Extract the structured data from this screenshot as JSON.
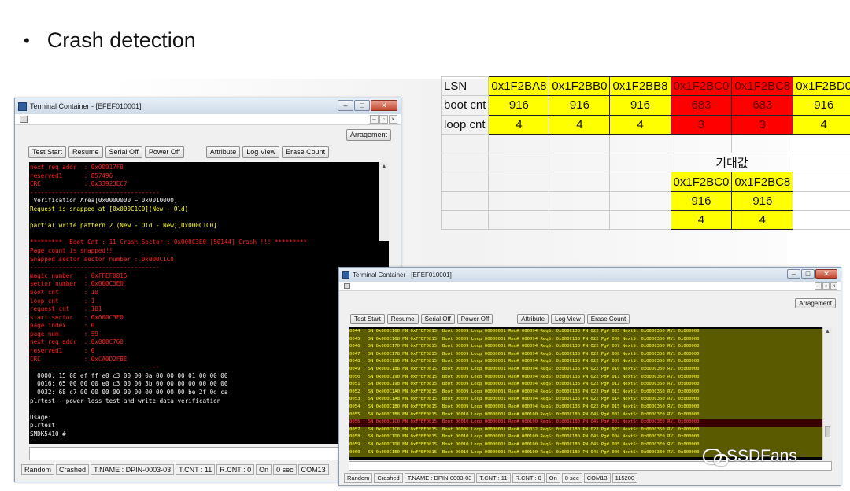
{
  "slide": {
    "bullet": "•",
    "title": "Crash detection"
  },
  "table": {
    "header_label": "LSN",
    "lsn": [
      "0x1F2BA8",
      "0x1F2BB0",
      "0x1F2BB8",
      "0x1F2BC0",
      "0x1F2BC8",
      "0x1F2BD0"
    ],
    "boot_label": "boot cnt",
    "boot": [
      "916",
      "916",
      "916",
      "683",
      "683",
      "916"
    ],
    "loop_label": "loop cnt",
    "loop": [
      "4",
      "4",
      "4",
      "3",
      "3",
      "4"
    ],
    "expected_label": "기대값",
    "expected_lsn": [
      "0x1F2BC0",
      "0x1F2BC8"
    ],
    "expected_boot": [
      "916",
      "916"
    ],
    "expected_loop": [
      "4",
      "4"
    ],
    "colors": {
      "ok": "#ffff00",
      "crash": "#ff0000"
    }
  },
  "win1": {
    "title": "Terminal Container - [EFEF010001]",
    "arrangement": "Arragement",
    "buttons": [
      "Test Start",
      "Resume",
      "Serial Off",
      "Power Off",
      "Attribute",
      "Log View",
      "Erase Count"
    ],
    "lines": [
      {
        "t": "next req addr  : 0x00017F8",
        "c": "c-red"
      },
      {
        "t": "reserved1      : 857496",
        "c": "c-red"
      },
      {
        "t": "CRC            : 0x33923EC7",
        "c": "c-red"
      },
      {
        "t": "------------------------------------",
        "c": "c-red"
      },
      {
        "t": " Verification Area[0x0000000 ~ 0x0010000]",
        "c": "c-wht"
      },
      {
        "t": "Request is snapped at [0x000C1C0](New - Old)",
        "c": "c-yel"
      },
      {
        "t": "",
        "c": "c-wht"
      },
      {
        "t": "partial write pattern 2 (New - Old - New)[0x000C1C0]",
        "c": "c-yel"
      },
      {
        "t": "",
        "c": "c-wht"
      },
      {
        "t": "*********  Boot Cnt : 11 Crash Sector : 0x000C3E0 [50144] Crash !!! *********",
        "c": "c-red"
      },
      {
        "t": "Page count is snapped!!",
        "c": "c-red"
      },
      {
        "t": "Snapped sector sector number : 0x000C1C0",
        "c": "c-red"
      },
      {
        "t": "------------------------------------",
        "c": "c-red"
      },
      {
        "t": "magic number   : 0xFFEF0815",
        "c": "c-red"
      },
      {
        "t": "sector number  : 0x000C3E0",
        "c": "c-red"
      },
      {
        "t": "boot cnt       : 10",
        "c": "c-red"
      },
      {
        "t": "loop cnt       : 1",
        "c": "c-red"
      },
      {
        "t": "request cnt    : 101",
        "c": "c-red"
      },
      {
        "t": "start sector   : 0x000C3E0",
        "c": "c-red"
      },
      {
        "t": "page index     : 0",
        "c": "c-red"
      },
      {
        "t": "page num       : 59",
        "c": "c-red"
      },
      {
        "t": "next req addr  : 0x000C760",
        "c": "c-red"
      },
      {
        "t": "reserved1      : 0",
        "c": "c-red"
      },
      {
        "t": "CRC            : 0xCA0D2FBE",
        "c": "c-red"
      },
      {
        "t": "------------------------------------",
        "c": "c-red"
      },
      {
        "t": "  0000: 15 08 ef ff e0 c3 00 00 0a 00 00 00 01 00 00 00",
        "c": "c-wht"
      },
      {
        "t": "  0016: 65 00 00 00 e0 c3 00 00 3b 00 00 00 00 00 00 00",
        "c": "c-wht"
      },
      {
        "t": "  0032: 68 c7 00 00 00 00 00 00 00 00 00 00 be 2f 0d ca",
        "c": "c-wht"
      },
      {
        "t": "plrtest - power loss test and write data verification",
        "c": "c-wht"
      },
      {
        "t": "",
        "c": "c-wht"
      },
      {
        "t": "Usage:",
        "c": "c-wht"
      },
      {
        "t": "plrtest",
        "c": "c-wht"
      },
      {
        "t": "SMDK5410 #",
        "c": "c-wht"
      }
    ],
    "status": [
      "Random",
      "Crashed",
      "T.NAME : DPIN-0003-03",
      "T.CNT : 11",
      "R.CNT : 0",
      "On",
      "0 sec",
      "COM13"
    ]
  },
  "win2": {
    "title": "Terminal Container - [EFEF010001]",
    "arrangement": "Arragement",
    "buttons": [
      "Test Start",
      "Resume",
      "Serial Off",
      "Power Off",
      "Attribute",
      "Log View",
      "Erase Count"
    ],
    "lines": [
      {
        "t": "0044 : SN 0x000C160 MN 0xFFEF0815  Boot 00009 Loop 00000001 Req# 000094 ReqSt 0x000C138 PN 022 Pg# 005 NextSt 0x000C350 RV1 0x000000",
        "c": "c-yh"
      },
      {
        "t": "0045 : SN 0x000C168 MN 0xFFEF0815  Boot 00009 Loop 00000001 Req# 000094 ReqSt 0x000C138 PN 022 Pg# 006 NextSt 0x000C350 RV1 0x000000",
        "c": "c-yh"
      },
      {
        "t": "0046 : SN 0x000C170 MN 0xFFEF0815  Boot 00009 Loop 00000001 Req# 000094 ReqSt 0x000C138 PN 022 Pg# 007 NextSt 0x000C350 RV1 0x000000",
        "c": "c-yh"
      },
      {
        "t": "0047 : SN 0x000C178 MN 0xFFEF0815  Boot 00009 Loop 00000001 Req# 000094 ReqSt 0x000C138 PN 022 Pg# 008 NextSt 0x000C350 RV1 0x000000",
        "c": "c-yh"
      },
      {
        "t": "0048 : SN 0x000C180 MN 0xFFEF0815  Boot 00009 Loop 00000001 Req# 000094 ReqSt 0x000C138 PN 022 Pg# 009 NextSt 0x000C350 RV1 0x000000",
        "c": "c-yh"
      },
      {
        "t": "0049 : SN 0x000C188 MN 0xFFEF0815  Boot 00009 Loop 00000001 Req# 000094 ReqSt 0x000C138 PN 022 Pg# 010 NextSt 0x000C350 RV1 0x000000",
        "c": "c-yh"
      },
      {
        "t": "0050 : SN 0x000C190 MN 0xFFEF0815  Boot 00009 Loop 00000001 Req# 000094 ReqSt 0x000C138 PN 022 Pg# 011 NextSt 0x000C350 RV1 0x000000",
        "c": "c-yh"
      },
      {
        "t": "0051 : SN 0x000C198 MN 0xFFEF0815  Boot 00009 Loop 00000001 Req# 000094 ReqSt 0x000C138 PN 022 Pg# 012 NextSt 0x000C350 RV1 0x000000",
        "c": "c-yh"
      },
      {
        "t": "0052 : SN 0x000C1A0 MN 0xFFEF0815  Boot 00009 Loop 00000001 Req# 000094 ReqSt 0x000C138 PN 022 Pg# 013 NextSt 0x000C350 RV1 0x000000",
        "c": "c-yh"
      },
      {
        "t": "0053 : SN 0x000C1A8 MN 0xFFEF0815  Boot 00009 Loop 00000001 Req# 000094 ReqSt 0x000C138 PN 022 Pg# 014 NextSt 0x000C350 RV1 0x000000",
        "c": "c-yh"
      },
      {
        "t": "0054 : SN 0x000C1B0 MN 0xFFEF0815  Boot 00009 Loop 00000001 Req# 000094 ReqSt 0x000C138 PN 022 Pg# 015 NextSt 0x000C350 RV1 0x000000",
        "c": "c-yh"
      },
      {
        "t": "0055 : SN 0x000C1B8 MN 0xFFEF0815  Boot 00010 Loop 00000001 Req# 000100 ReqSt 0x000C1B0 PN 045 Pg# 001 NextSt 0x000C3E0 RV1 0x000000",
        "c": "c-yh"
      },
      {
        "t": "0056 : SN 0x000C1C0 MN 0xFFEF0815  Boot 00010 Loop 00000001 Req# 000100 ReqSt 0x000C1B0 PN 045 Pg# 002 NextSt 0x000C3E0 RV1 0x000000",
        "c": "c-redh"
      },
      {
        "t": "0057 : SN 0x000C1C8 MN 0xFFEF0815  Boot 00006 Loop 00000001 Req# 000032 ReqSt 0x000C1B0 PN 022 Pg# 023 NextSt 0x000C350 RV1 0x000000",
        "c": "c-yh"
      },
      {
        "t": "0058 : SN 0x000C1D0 MN 0xFFEF0815  Boot 00010 Loop 00000001 Req# 000100 ReqSt 0x000C1B0 PN 045 Pg# 004 NextSt 0x000C3E0 RV1 0x000000",
        "c": "c-yh"
      },
      {
        "t": "0059 : SN 0x000C1D8 MN 0xFFEF0815  Boot 00010 Loop 00000001 Req# 000100 ReqSt 0x000C1B0 PN 045 Pg# 005 NextSt 0x000C3E0 RV1 0x000000",
        "c": "c-yh"
      },
      {
        "t": "0060 : SN 0x000C1E0 MN 0xFFEF0815  Boot 00010 Loop 00000001 Req# 000100 ReqSt 0x000C1B0 PN 045 Pg# 006 NextSt 0x000C3E0 RV1 0x000000",
        "c": "c-yh"
      }
    ],
    "status": [
      "Random",
      "Crashed",
      "T.NAME : DPIN-0003-03",
      "T.CNT : 11",
      "R.CNT : 0",
      "On",
      "0 sec",
      "COM13",
      "115200"
    ]
  },
  "watermark": "SSDFans"
}
